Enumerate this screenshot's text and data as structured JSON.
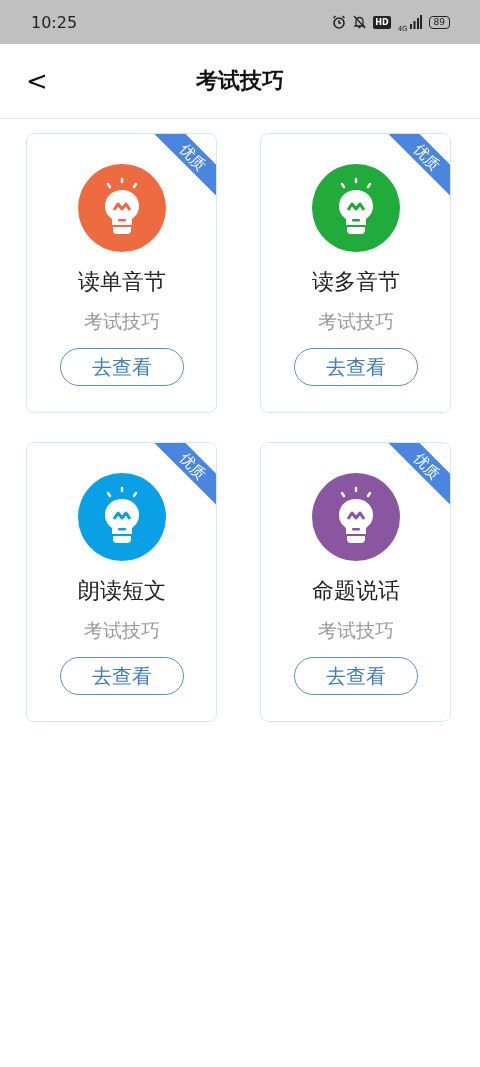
{
  "status_bar": {
    "time": "10:25",
    "hd": "HD",
    "network": "4G",
    "battery": "89"
  },
  "header": {
    "back": "<",
    "title": "考试技巧"
  },
  "cards": [
    {
      "title": "读单音节",
      "subtitle": "考试技巧",
      "button": "去查看",
      "badge": "优质",
      "color": "#ee6a41"
    },
    {
      "title": "读多音节",
      "subtitle": "考试技巧",
      "button": "去查看",
      "badge": "优质",
      "color": "#21ab3a"
    },
    {
      "title": "朗读短文",
      "subtitle": "考试技巧",
      "button": "去查看",
      "badge": "优质",
      "color": "#0aa0e6"
    },
    {
      "title": "命题说话",
      "subtitle": "考试技巧",
      "button": "去查看",
      "badge": "优质",
      "color": "#8a55a1"
    }
  ]
}
